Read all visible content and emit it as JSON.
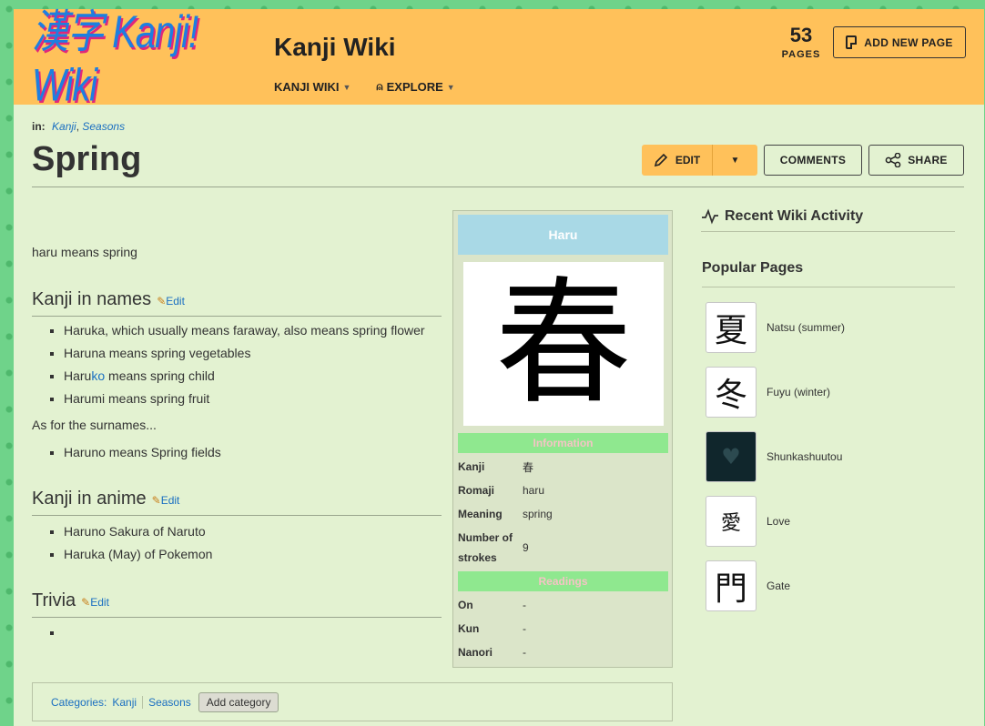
{
  "header": {
    "logo_text": "漢字 Kanji! Wiki",
    "wiki_title": "Kanji Wiki",
    "nav": [
      {
        "label": "KANJI WIKI"
      },
      {
        "label": "EXPLORE"
      }
    ],
    "page_count": "53",
    "page_count_label": "PAGES",
    "add_page_label": "ADD NEW PAGE"
  },
  "article": {
    "breadcrumb_prefix": "in:",
    "breadcrumb_links": [
      "Kanji",
      "Seasons"
    ],
    "title": "Spring",
    "actions": {
      "edit": "EDIT",
      "comments": "COMMENTS",
      "share": "SHARE"
    },
    "intro": "haru means spring",
    "edit_link": "Edit",
    "sections": {
      "names": {
        "heading": "Kanji in names",
        "items": [
          "Haruka, which usually means faraway, also means spring flower",
          "Haruna means spring vegetables",
          {
            "pre": "Haru",
            "hl": "ko",
            "post": " means spring child"
          },
          "Harumi means spring fruit"
        ],
        "surnames_text": "As for the surnames...",
        "surname_items": [
          "Haruno means Spring fields"
        ]
      },
      "anime": {
        "heading": "Kanji in anime",
        "items": [
          "Haruno Sakura of Naruto",
          "Haruka (May) of Pokemon"
        ]
      },
      "trivia": {
        "heading": "Trivia",
        "items": [
          ""
        ]
      }
    },
    "categories": {
      "label": "Categories:",
      "items": [
        "Kanji",
        "Seasons"
      ],
      "add_label": "Add category"
    }
  },
  "infobox": {
    "title": "Haru",
    "kanji_glyph": "春",
    "information_heading": "Information",
    "info_rows": [
      {
        "key": "Kanji",
        "value": "春"
      },
      {
        "key": "Romaji",
        "value": "haru"
      },
      {
        "key": "Meaning",
        "value": "spring"
      },
      {
        "key": "Number of strokes",
        "value": "9"
      }
    ],
    "readings_heading": "Readings",
    "reading_rows": [
      {
        "key": "On",
        "value": "-"
      },
      {
        "key": "Kun",
        "value": "-"
      },
      {
        "key": "Nanori",
        "value": "-"
      }
    ]
  },
  "rail": {
    "activity_heading": "Recent Wiki Activity",
    "popular_heading": "Popular Pages",
    "popular": [
      {
        "label": "Natsu (summer)",
        "glyph": "夏"
      },
      {
        "label": "Fuyu (winter)",
        "glyph": "冬"
      },
      {
        "label": "Shunkashuutou",
        "glyph": "♥"
      },
      {
        "label": "Love",
        "glyph": "愛"
      },
      {
        "label": "Gate",
        "glyph": "門"
      }
    ]
  },
  "colors": {
    "header_bg": "#ffc15a",
    "page_bg": "#e3f2d1",
    "link": "#1a6fc1",
    "infobox_title_bg": "#a9d9e6",
    "infobox_band_bg": "#8fe88f"
  }
}
